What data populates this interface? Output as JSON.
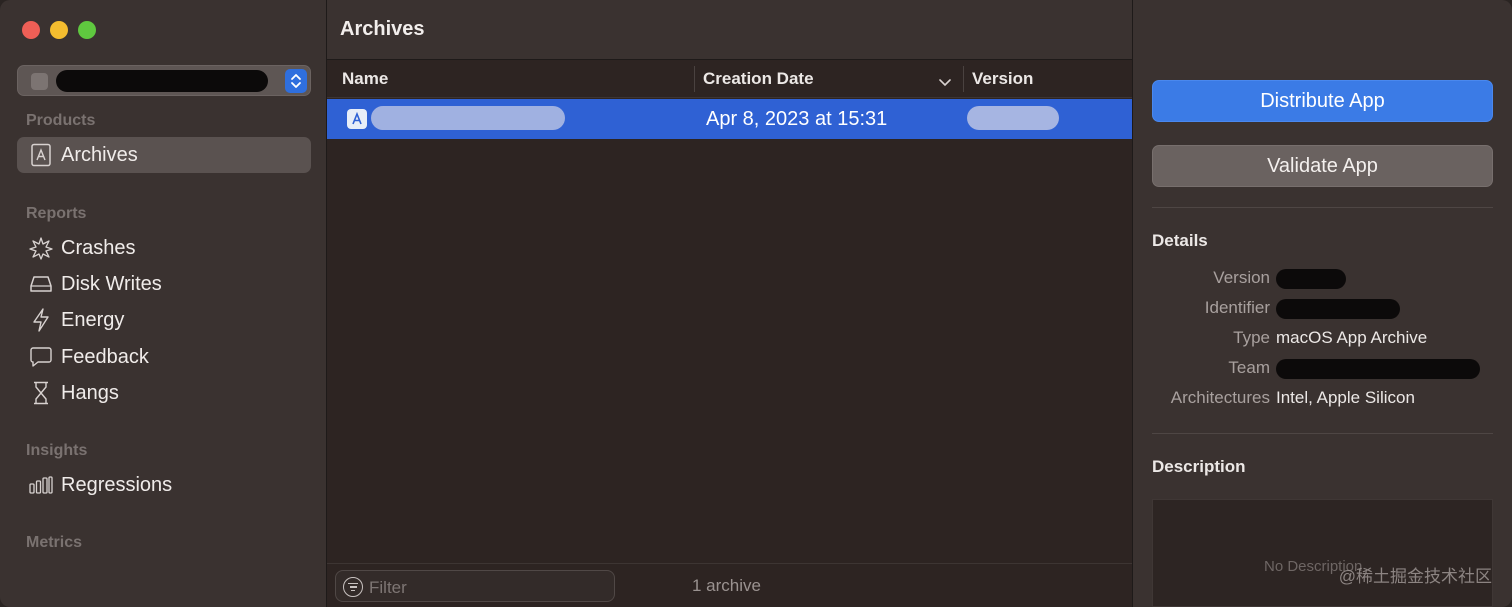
{
  "sidebar": {
    "sections": {
      "products": "Products",
      "reports": "Reports",
      "insights": "Insights",
      "metrics": "Metrics"
    },
    "items": {
      "archives": "Archives",
      "crashes": "Crashes",
      "disk_writes": "Disk Writes",
      "energy": "Energy",
      "feedback": "Feedback",
      "hangs": "Hangs",
      "regressions": "Regressions"
    },
    "selected": "archives"
  },
  "main": {
    "title": "Archives",
    "columns": {
      "name": "Name",
      "creation_date": "Creation Date",
      "version": "Version"
    },
    "rows": [
      {
        "creation_date": "Apr 8, 2023 at 15:31"
      }
    ],
    "filter_placeholder": "Filter",
    "count": "1 archive"
  },
  "inspector": {
    "distribute_label": "Distribute App",
    "validate_label": "Validate App",
    "details_heading": "Details",
    "details": {
      "version_key": "Version",
      "identifier_key": "Identifier",
      "type_key": "Type",
      "type_value": "macOS App Archive",
      "team_key": "Team",
      "architectures_key": "Architectures",
      "architectures_value": "Intel, Apple Silicon"
    },
    "description_heading": "Description",
    "description_empty": "No Description"
  },
  "watermark": "@稀土掘金技术社区",
  "colors": {
    "accent": "#2f61d4",
    "primary_button": "#3b7be6",
    "sidebar_bg": "#3a3230",
    "content_bg": "#2d2422"
  },
  "icons": {
    "archives": "archive-box-icon",
    "crashes": "burst-icon",
    "disk_writes": "disk-icon",
    "energy": "bolt-icon",
    "feedback": "speech-bubble-icon",
    "hangs": "hourglass-icon",
    "regressions": "bar-chart-icon"
  }
}
